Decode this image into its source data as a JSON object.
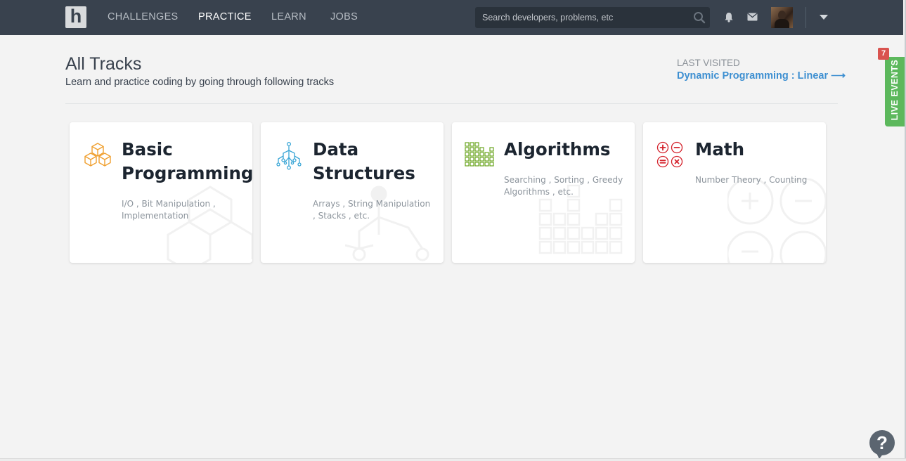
{
  "nav": {
    "logo": "h",
    "items": [
      {
        "label": "CHALLENGES",
        "active": false
      },
      {
        "label": "PRACTICE",
        "active": true
      },
      {
        "label": "LEARN",
        "active": false
      },
      {
        "label": "JOBS",
        "active": false
      }
    ],
    "search_placeholder": "Search developers, problems, etc",
    "icons": [
      "search-icon",
      "bell-icon",
      "mail-icon",
      "caret-down-icon"
    ]
  },
  "header": {
    "title": "All Tracks",
    "subtitle": "Learn and practice coding by going through following tracks",
    "last_visited_label": "LAST VISITED",
    "last_visited_link": "Dynamic Programming : Linear ⟶"
  },
  "tracks": [
    {
      "title_line1": "Basic",
      "title_line2": "Programming",
      "description": "I/O , Bit Manipulation , Implementation",
      "icon": "cubes-icon",
      "color": "#f0a030"
    },
    {
      "title_line1": "Data",
      "title_line2": "Structures",
      "description": "Arrays , String Manipulation , Stacks , etc.",
      "icon": "tree-icon",
      "color": "#3aa6d6"
    },
    {
      "title_line1": "Algorithms",
      "title_line2": "",
      "description": "Searching , Sorting , Greedy Algorithms , etc.",
      "icon": "grid-bars-icon",
      "color": "#6aa520"
    },
    {
      "title_line1": "Math",
      "title_line2": "",
      "description": "Number Theory , Counting",
      "icon": "math-operators-icon",
      "color": "#d4202a"
    }
  ],
  "live_events": {
    "label": "LIVE EVENTS",
    "badge": "7"
  },
  "help": {
    "label": "?"
  }
}
